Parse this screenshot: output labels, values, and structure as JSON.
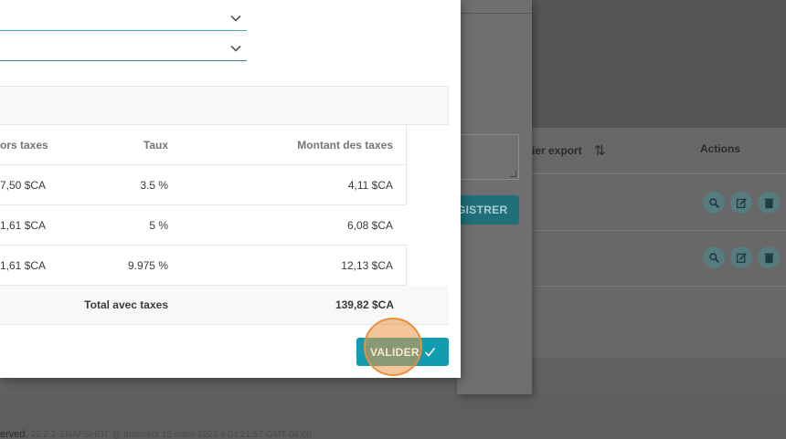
{
  "background": {
    "save_button_label": "GISTRER",
    "table": {
      "export_header": "ier export",
      "actions_header": "Actions",
      "rows": [
        {
          "actions": [
            "zoom-icon",
            "edit-icon",
            "trash-icon"
          ]
        },
        {
          "actions": [
            "zoom-icon",
            "edit-icon",
            "trash-icon"
          ]
        }
      ]
    },
    "footer": {
      "reserved": "erved.",
      "version": "22.2.2-SNAPSHOT @ mercredi 15 mars 2023 à 04:21:57 GMT-04:00"
    }
  },
  "modal": {
    "tax_table": {
      "headers": {
        "ht": "ors taxes",
        "taux": "Taux",
        "montant": "Montant des taxes"
      },
      "rows": [
        {
          "ht": "7,50 $CA",
          "taux": "3.5 %",
          "montant": "4,11 $CA"
        },
        {
          "ht": "1,61 $CA",
          "taux": "5 %",
          "montant": "6,08 $CA"
        },
        {
          "ht": "1,61 $CA",
          "taux": "9.975 %",
          "montant": "12,13 $CA"
        }
      ],
      "total_label": "Total avec taxes",
      "total_value": "139,82 $CA"
    },
    "valider_label": "VALIDER"
  },
  "colors": {
    "accent": "#139bb0",
    "click_marker": "#e69040"
  }
}
